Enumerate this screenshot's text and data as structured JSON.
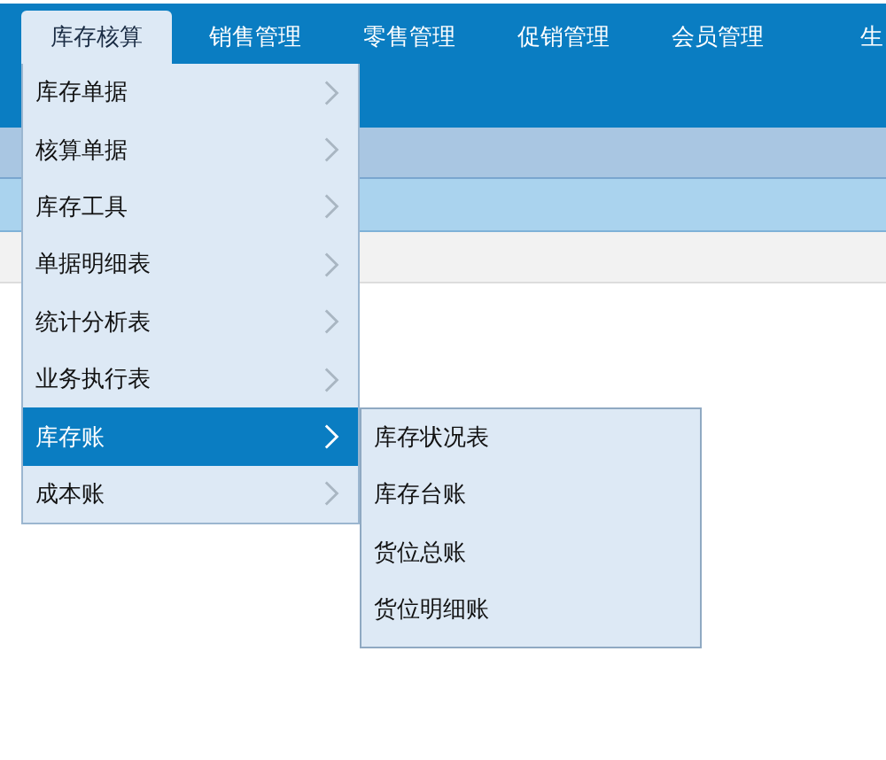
{
  "nav_tabs": [
    {
      "label": "库存核算",
      "selected": true
    },
    {
      "label": "销售管理",
      "selected": false
    },
    {
      "label": "零售管理",
      "selected": false
    },
    {
      "label": "促销管理",
      "selected": false
    },
    {
      "label": "会员管理",
      "selected": false
    },
    {
      "label": "生",
      "selected": false
    }
  ],
  "menu": {
    "items": [
      {
        "label": "库存单据",
        "selected": false
      },
      {
        "label": "核算单据",
        "selected": false
      },
      {
        "label": "库存工具",
        "selected": false
      },
      {
        "label": "单据明细表",
        "selected": false
      },
      {
        "label": "统计分析表",
        "selected": false
      },
      {
        "label": "业务执行表",
        "selected": false
      },
      {
        "label": "库存账",
        "selected": true
      },
      {
        "label": "成本账",
        "selected": false
      }
    ]
  },
  "submenu": {
    "items": [
      {
        "label": "库存状况表"
      },
      {
        "label": "库存台账"
      },
      {
        "label": "货位总账"
      },
      {
        "label": "货位明细账"
      }
    ]
  }
}
